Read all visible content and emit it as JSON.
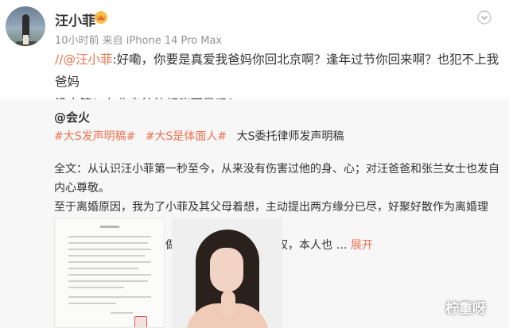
{
  "post": {
    "username": "汪小菲",
    "meta": "10小时前 来自 iPhone 14 Pro Max",
    "mention": "//@汪小菲",
    "text_rest": ":好嘞，你要是真爱我爸妈你回北京啊？逢年过节你回来啊？也犯不上我爸妈\n没人管！在北京待待都能死是吗？"
  },
  "repost": {
    "author": "@会火",
    "tags": [
      "#大S发声明稿#",
      "#大S是体面人#"
    ],
    "tag_tail": "大S委托律师发声明稿",
    "body": "全文：从认识汪小菲第一秒至今，从来没有伤害过他的身、心；对汪爸爸和张兰女士也发自内心尊敬。\n至于离婚原因，我为了小菲及其父母着想，主动提出两方缘分已尽，好聚好散作为离婚理由，并保证此\n生不出恶言，我也说到做到。对于孩子的监护权，本人也 … ",
    "expand": "展开"
  },
  "icons": {
    "vip": "vip-badge-icon",
    "follow": "follow-icon"
  },
  "watermark": "柠重呀",
  "colors": {
    "link": "#eb7350",
    "repost_bg": "#f7f7f7",
    "meta": "#939393"
  }
}
